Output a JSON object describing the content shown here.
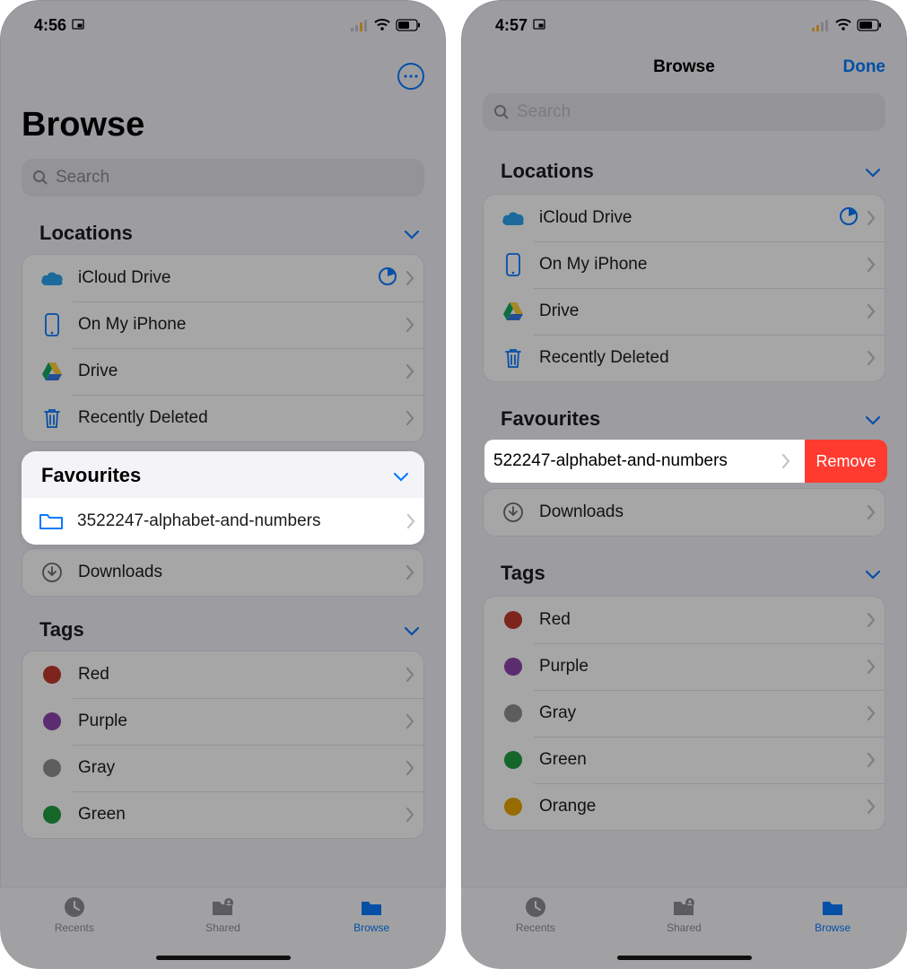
{
  "left": {
    "status": {
      "time": "4:56"
    },
    "title": "Browse",
    "search_placeholder": "Search",
    "sections": {
      "locations": {
        "header": "Locations",
        "items": [
          {
            "label": "iCloud Drive"
          },
          {
            "label": "On My iPhone"
          },
          {
            "label": "Drive"
          },
          {
            "label": "Recently Deleted"
          }
        ]
      },
      "favourites": {
        "header": "Favourites",
        "items": [
          {
            "label": "3522247-alphabet-and-numbers"
          },
          {
            "label": "Downloads"
          }
        ]
      },
      "tags": {
        "header": "Tags",
        "items": [
          {
            "label": "Red",
            "color": "#c0392b"
          },
          {
            "label": "Purple",
            "color": "#8e44ad"
          },
          {
            "label": "Gray",
            "color": "#909093"
          },
          {
            "label": "Green",
            "color": "#1f9d3f"
          }
        ]
      }
    },
    "tabs": {
      "recents": "Recents",
      "shared": "Shared",
      "browse": "Browse"
    }
  },
  "right": {
    "status": {
      "time": "4:57"
    },
    "nav_title": "Browse",
    "done": "Done",
    "search_placeholder": "Search",
    "sections": {
      "locations": {
        "header": "Locations",
        "items": [
          {
            "label": "iCloud Drive"
          },
          {
            "label": "On My iPhone"
          },
          {
            "label": "Drive"
          },
          {
            "label": "Recently Deleted"
          }
        ]
      },
      "favourites": {
        "header": "Favourites",
        "swiped": {
          "label": "522247-alphabet-and-numbers",
          "action": "Remove"
        },
        "items": [
          {
            "label": "Downloads"
          }
        ]
      },
      "tags": {
        "header": "Tags",
        "items": [
          {
            "label": "Red",
            "color": "#c0392b"
          },
          {
            "label": "Purple",
            "color": "#8e44ad"
          },
          {
            "label": "Gray",
            "color": "#909093"
          },
          {
            "label": "Green",
            "color": "#1f9d3f"
          },
          {
            "label": "Orange",
            "color": "#e6a500"
          }
        ]
      }
    },
    "tabs": {
      "recents": "Recents",
      "shared": "Shared",
      "browse": "Browse"
    }
  }
}
